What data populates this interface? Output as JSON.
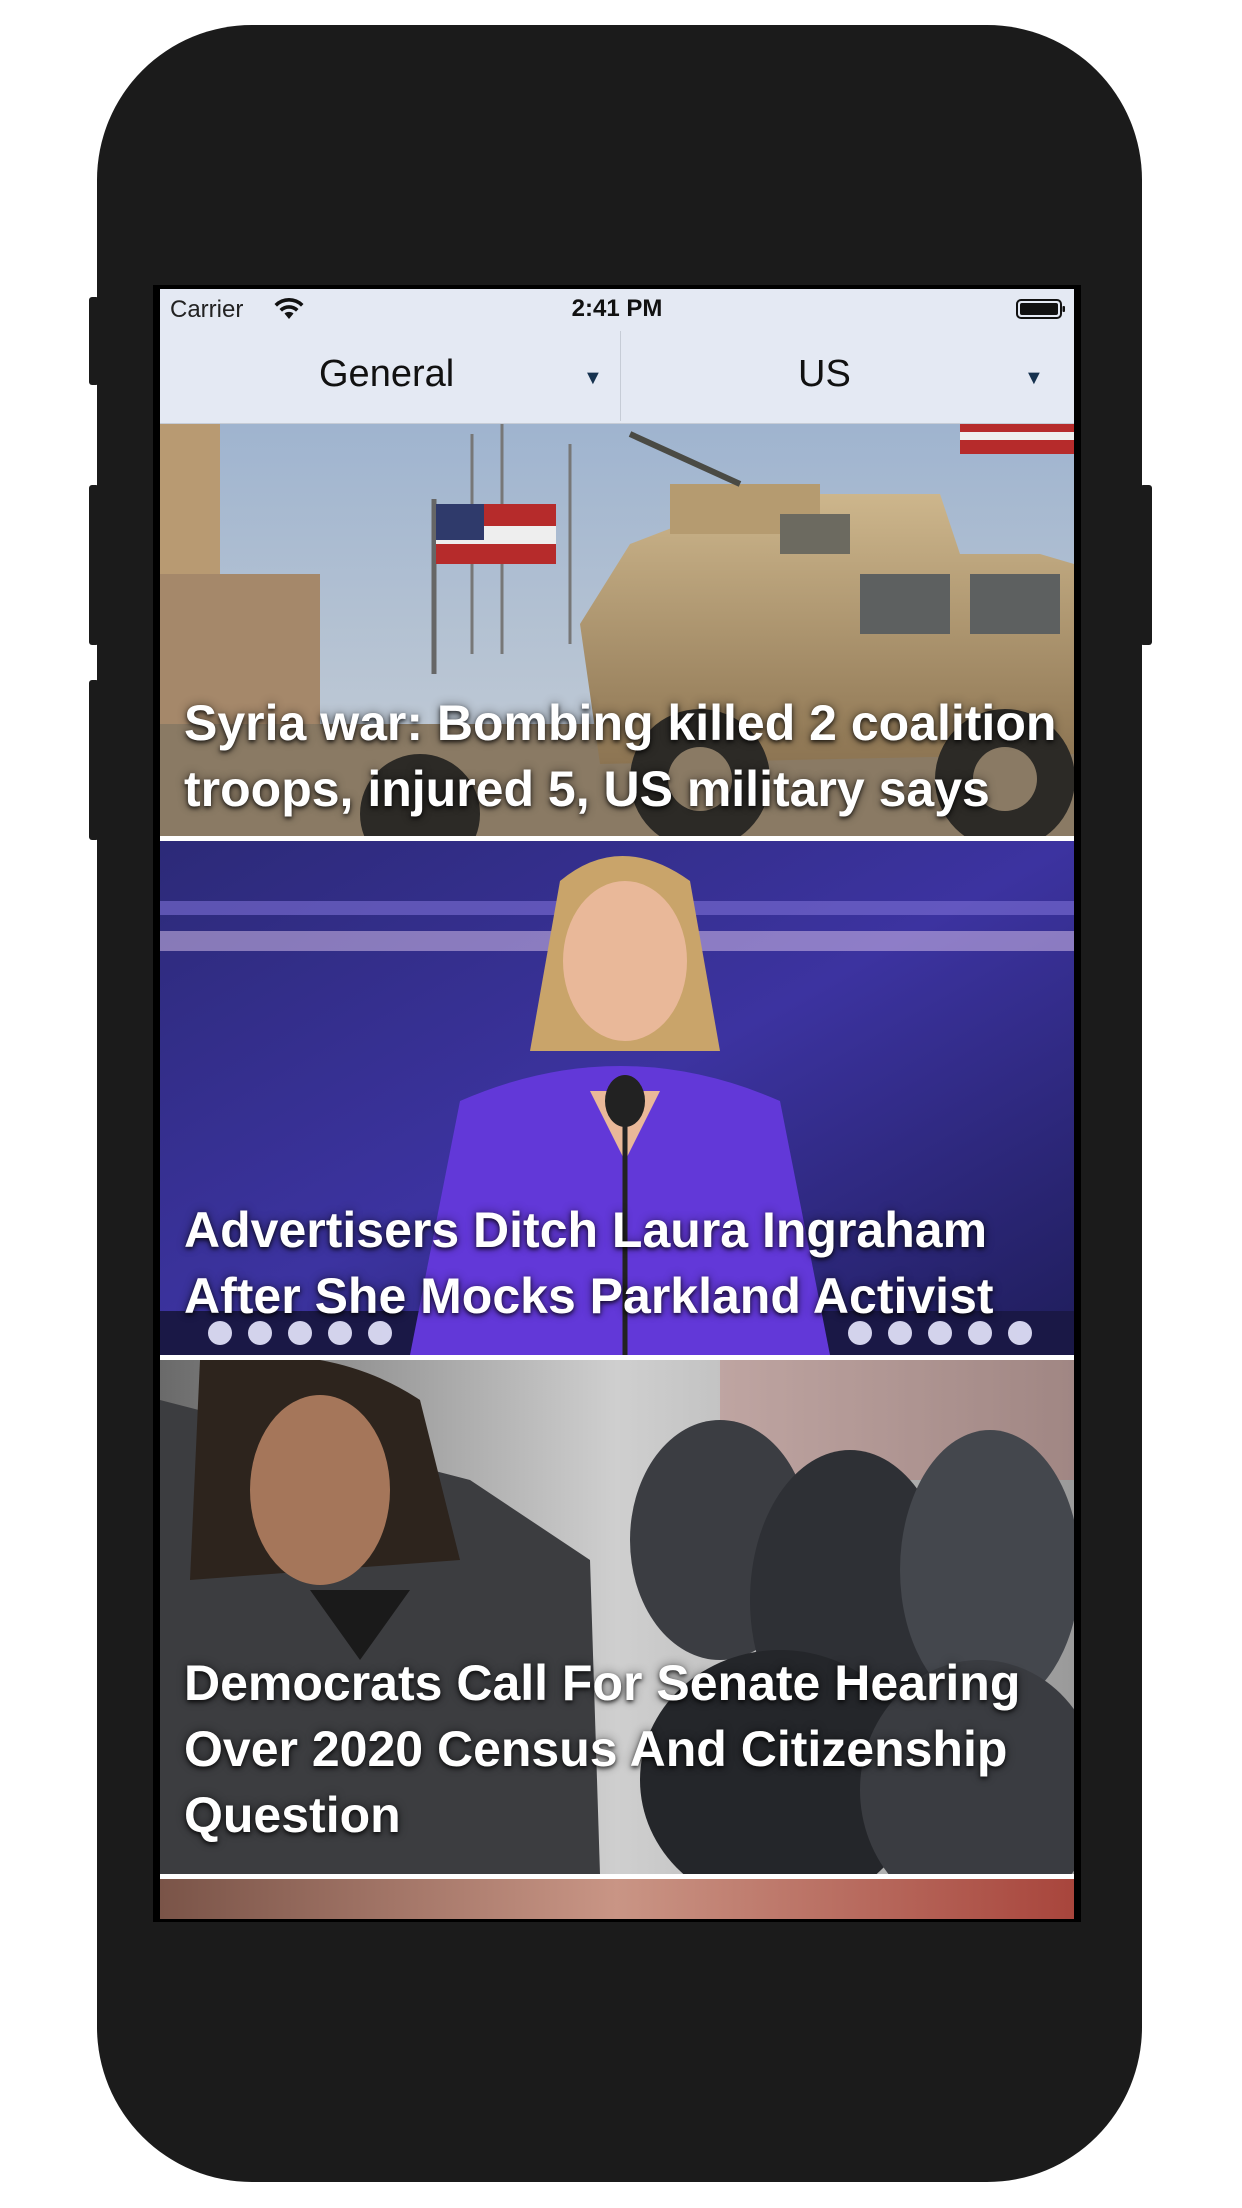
{
  "status_bar": {
    "carrier": "Carrier",
    "time": "2:41 PM",
    "icons": [
      "wifi-icon",
      "battery-icon"
    ]
  },
  "filters": {
    "category": {
      "selected": "General",
      "icon": "caret-down-icon"
    },
    "country": {
      "selected": "US",
      "icon": "caret-down-icon"
    }
  },
  "articles": [
    {
      "title": "Syria war: Bombing killed 2 coalition troops, injured 5, US military says"
    },
    {
      "title": "Advertisers Ditch Laura Ingraham After She Mocks Parkland Activist"
    },
    {
      "title": "Democrats Call For Senate Hearing Over 2020 Census And Citizenship Question"
    },
    {
      "title": ""
    }
  ],
  "colors": {
    "device_frame": "#1b1b1b",
    "header_background": "#e4e9f3",
    "caret": "#16324f",
    "title_text": "#ffffff"
  }
}
